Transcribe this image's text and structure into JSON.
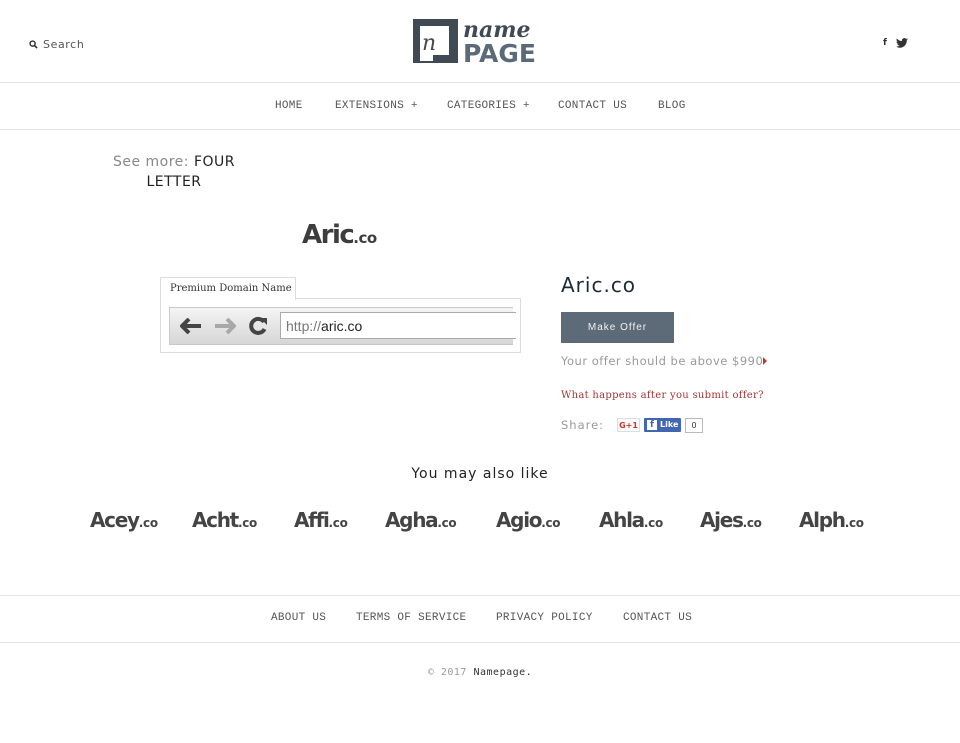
{
  "header": {
    "search_label": "Search",
    "logo": {
      "word_top": "name",
      "word_bottom": "PAGE",
      "monogram": "n"
    },
    "social": [
      {
        "icon": "facebook-icon",
        "glyph": "f"
      },
      {
        "icon": "twitter-icon",
        "glyph": "🐦"
      }
    ]
  },
  "nav": {
    "items": [
      {
        "label": "HOME"
      },
      {
        "label": "EXTENSIONS +"
      },
      {
        "label": "CATEGORIES +"
      },
      {
        "label": "CONTACT US"
      },
      {
        "label": "BLOG"
      }
    ]
  },
  "see_more": {
    "label": "See more:",
    "link": "FOUR LETTER"
  },
  "domain": {
    "logo_name": "Aric",
    "logo_tld": ".co",
    "tab_label": "Premium Domain Name",
    "url_prefix": "http://",
    "url_host": "aric.co",
    "title": "Aric.co"
  },
  "offer": {
    "button_label": "Make Offer",
    "note": "Your offer should be above $990",
    "help_link": "What happens after you submit offer?",
    "share_label": "Share:",
    "gplus_label": "G+1",
    "fb_label": "Like",
    "fb_count": "0"
  },
  "also_like": {
    "title": "You may also like",
    "items": [
      {
        "name": "Acey",
        "tld": ".co"
      },
      {
        "name": "Acht",
        "tld": ".co"
      },
      {
        "name": "Affi",
        "tld": ".co"
      },
      {
        "name": "Agha",
        "tld": ".co"
      },
      {
        "name": "Agio",
        "tld": ".co"
      },
      {
        "name": "Ahla",
        "tld": ".co"
      },
      {
        "name": "Ajes",
        "tld": ".co"
      },
      {
        "name": "Alph",
        "tld": ".co"
      }
    ]
  },
  "footer": {
    "links": [
      {
        "label": "ABOUT US"
      },
      {
        "label": "TERMS OF SERVICE"
      },
      {
        "label": "PRIVACY POLICY"
      },
      {
        "label": "CONTACT US"
      }
    ],
    "copyright_prefix": "© 2017",
    "brand": "Namepage."
  },
  "colors": {
    "button_bg": "#5d6b78",
    "help_link": "#a23434",
    "facebook": "#4267b2",
    "logo_dark": "#3f4a55",
    "logo_accent": "#5a6a78"
  }
}
